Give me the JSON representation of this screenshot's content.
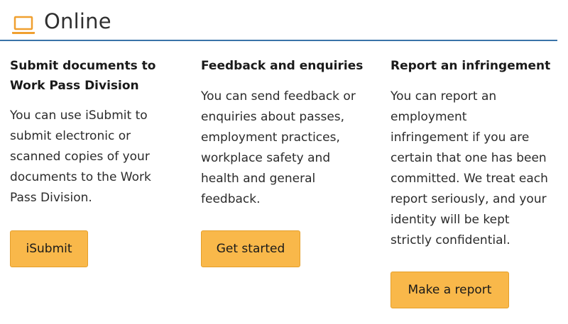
{
  "section": {
    "title": "Online",
    "icon": "laptop-icon",
    "accent_color": "#3a73a8",
    "icon_color": "#f0a030"
  },
  "columns": [
    {
      "title": "Submit documents to Work Pass Division",
      "body": "You can use iSubmit to\nsubmit electronic or\nscanned copies of your\ndocuments to the Work\nPass Division.",
      "button_label": "iSubmit"
    },
    {
      "title": "Feedback and enquiries",
      "body": "You can send feedback or\nenquiries about passes,\nemployment practices,\nworkplace safety and\nhealth and general\nfeedback.",
      "button_label": "Get started"
    },
    {
      "title": "Report an infringement",
      "body": "You can report an\nemployment\ninfringement if you are\ncertain that one has been\ncommitted. We treat each\nreport seriously, and your\nidentity will be kept\nstrictly confidential.",
      "button_label": "Make a report"
    }
  ],
  "colors": {
    "button_bg": "#f9b84a",
    "button_border": "#e59f2a"
  }
}
